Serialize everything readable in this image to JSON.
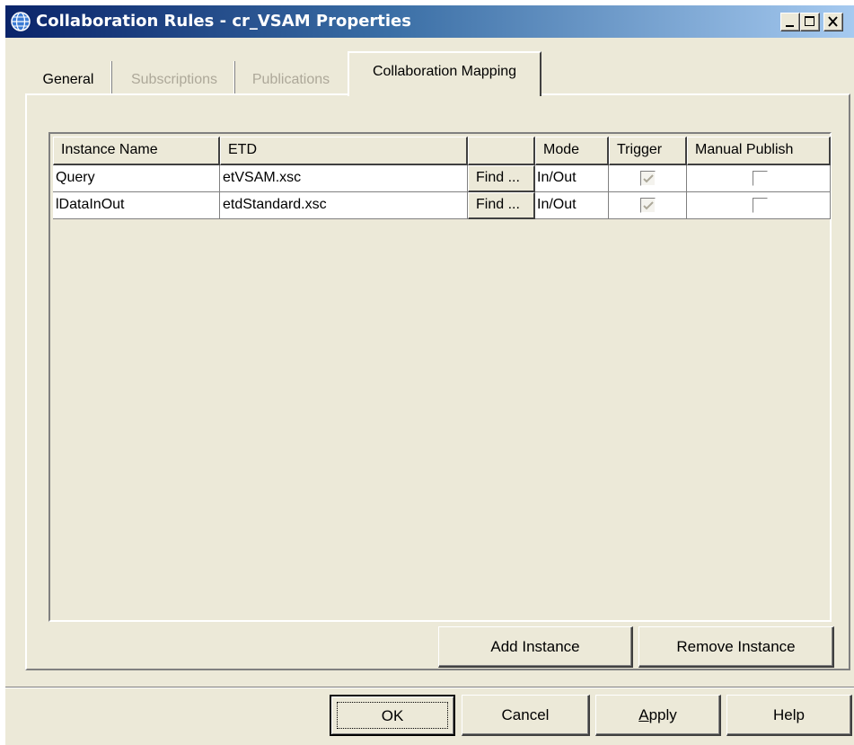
{
  "window": {
    "title": "Collaboration Rules - cr_VSAM Properties",
    "title_icon": "globe-icon",
    "controls": [
      "minimize-icon",
      "maximize-icon",
      "close-icon"
    ]
  },
  "tabs": [
    {
      "label": "General",
      "state": "enabled"
    },
    {
      "label": "Subscriptions",
      "state": "disabled"
    },
    {
      "label": "Publications",
      "state": "disabled"
    },
    {
      "label": "Collaboration Mapping",
      "state": "selected"
    }
  ],
  "table": {
    "columns": [
      "Instance Name",
      "ETD",
      "",
      "Mode",
      "Trigger",
      "Manual Publish"
    ],
    "rows": [
      {
        "instance_name": "Query",
        "etd": "etVSAM.xsc",
        "find_label": "Find ...",
        "mode": "In/Out",
        "trigger": true,
        "manual_publish": false
      },
      {
        "instance_name": "lDataInOut",
        "etd": "etdStandard.xsc",
        "find_label": "Find ...",
        "mode": "In/Out",
        "trigger": true,
        "manual_publish": false
      }
    ]
  },
  "panel_buttons": {
    "add_instance": "Add Instance",
    "remove_instance": "Remove Instance"
  },
  "dialog_buttons": {
    "ok": "OK",
    "cancel": "Cancel",
    "apply_mnemonic": "A",
    "apply_rest": "pply",
    "help": "Help"
  },
  "colors": {
    "face": "#ece9d8",
    "title_start": "#0a246a",
    "title_end": "#a6caf0",
    "disabled_text": "#ada899"
  }
}
